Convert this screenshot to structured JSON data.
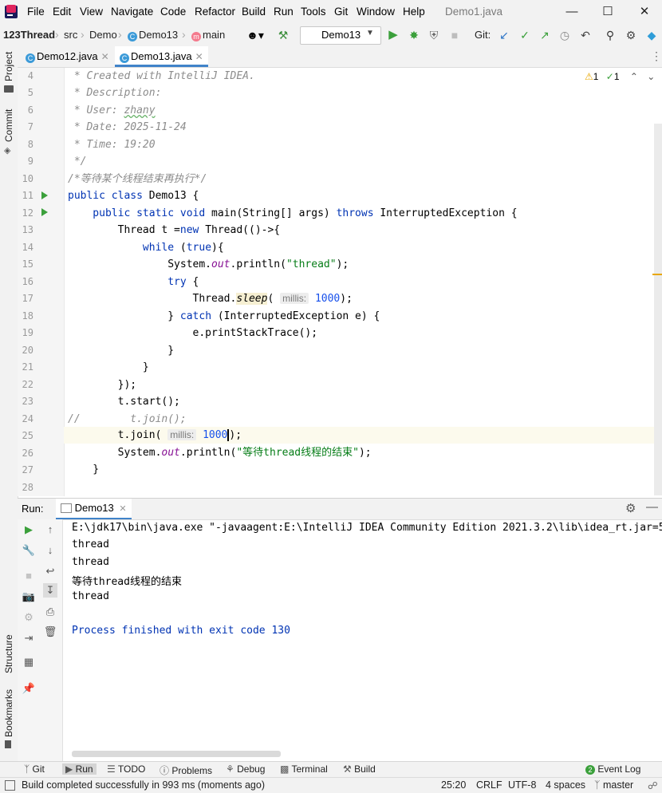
{
  "menu": {
    "items": [
      "File",
      "Edit",
      "View",
      "Navigate",
      "Code",
      "Refactor",
      "Build",
      "Run",
      "Tools",
      "Git",
      "Window",
      "Help"
    ],
    "window_title": "Demo1.java"
  },
  "navbar": {
    "crumbs": [
      "123Thread",
      "src",
      "Demo",
      "Demo13",
      "main"
    ],
    "run_config": "Demo13",
    "git_label": "Git:"
  },
  "left_tools": [
    "Project",
    "Commit",
    "Structure",
    "Bookmarks"
  ],
  "tabs": [
    {
      "label": "Demo12.java",
      "active": false
    },
    {
      "label": "Demo13.java",
      "active": true
    }
  ],
  "inspections": {
    "warnings": "1",
    "ok": "1"
  },
  "code": {
    "line_numbers": [
      "4",
      "5",
      "6",
      "7",
      "8",
      "9",
      "10",
      "11",
      "12",
      "13",
      "14",
      "15",
      "16",
      "17",
      "18",
      "19",
      "20",
      "21",
      "22",
      "23",
      "24",
      "25",
      "26",
      "27",
      "28"
    ],
    "l4": " * Created with IntelliJ IDEA.",
    "l5": " * Description:",
    "l6a": " * User: ",
    "l6b": "zhany",
    "l7": " * Date: 2025-11-24",
    "l8": " * Time: 19:20",
    "l9": " */",
    "l10": "/*等待某个线程结束再执行*/",
    "l11a": "public class",
    "l11b": " Demo13 {",
    "l12a": "    public static void",
    "l12b": " main(String[] args) ",
    "l12c": "throws",
    "l12d": " InterruptedException {",
    "l13a": "        Thread t =",
    "l13b": "new",
    "l13c": " Thread(()->{",
    "l14a": "            while",
    "l14b": " (",
    "l14c": "true",
    "l14d": "){",
    "l15a": "                System.",
    "l15b": "out",
    "l15c": ".println(",
    "l15d": "\"thread\"",
    "l15e": ");",
    "l16a": "                try",
    "l16b": " {",
    "l17a": "                    Thread.",
    "l17b": "sleep",
    "l17c": "( ",
    "l17h": "millis:",
    "l17d": "1000",
    "l17e": ");",
    "l18a": "                } ",
    "l18b": "catch",
    "l18c": " (InterruptedException e) {",
    "l19": "                    e.printStackTrace();",
    "l20": "                }",
    "l21": "            }",
    "l22": "        });",
    "l23": "        t.start();",
    "l24": "//        t.join();",
    "l25a": "        t.join( ",
    "l25h": "millis:",
    "l25b": "1000",
    "l25c": ");",
    "l26a": "        System.",
    "l26b": "out",
    "l26c": ".println(",
    "l26d": "\"等待thread线程的结束\"",
    "l26e": ");",
    "l27": "    }",
    "l28": ""
  },
  "run_panel": {
    "label": "Run:",
    "tab": "Demo13",
    "output": [
      "E:\\jdk17\\bin\\java.exe \"-javaagent:E:\\IntelliJ IDEA Community Edition 2021.3.2\\lib\\idea_rt.jar=5",
      "thread",
      "thread",
      "等待thread线程的结束",
      "thread",
      "",
      "Process finished with exit code 130"
    ]
  },
  "bottom_tools": [
    "Git",
    "Run",
    "TODO",
    "Problems",
    "Debug",
    "Terminal",
    "Build"
  ],
  "event_log": "Event Log",
  "status": {
    "message": "Build completed successfully in 993 ms (moments ago)",
    "position": "25:20",
    "line_sep": "CRLF",
    "encoding": "UTF-8",
    "indent": "4 spaces",
    "branch": "master"
  }
}
